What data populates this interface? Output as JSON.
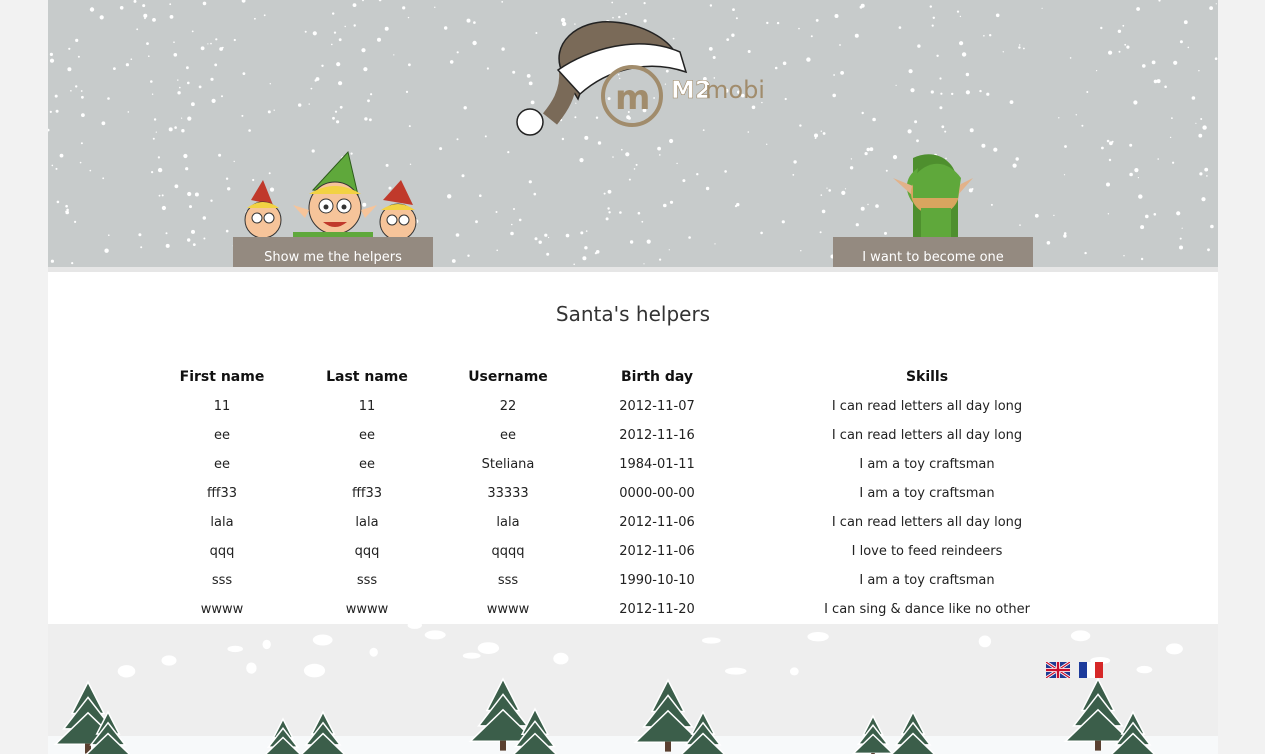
{
  "nav": {
    "helpers_label": "Show me the helpers",
    "become_label": "I want to become one"
  },
  "logo": {
    "text": "M2mobi",
    "brand_color": "#a18c6c"
  },
  "main": {
    "title": "Santa's helpers",
    "columns": [
      "First name",
      "Last name",
      "Username",
      "Birth day",
      "Skills"
    ],
    "rows": [
      [
        "11",
        "11",
        "22",
        "2012-11-07",
        "I can read letters all day long"
      ],
      [
        "ee",
        "ee",
        "ee",
        "2012-11-16",
        "I can read letters all day long"
      ],
      [
        "ee",
        "ee",
        "Steliana",
        "1984-01-11",
        "I am a toy craftsman"
      ],
      [
        "fff33",
        "fff33",
        "33333",
        "0000-00-00",
        "I am a toy craftsman"
      ],
      [
        "lala",
        "lala",
        "lala",
        "2012-11-06",
        "I can read letters all day long"
      ],
      [
        "qqq",
        "qqq",
        "qqqq",
        "2012-11-06",
        "I love to feed reindeers"
      ],
      [
        "sss",
        "sss",
        "sss",
        "1990-10-10",
        "I am a toy craftsman"
      ],
      [
        "wwww",
        "wwww",
        "wwww",
        "2012-11-20",
        "I can sing & dance like no other"
      ]
    ]
  },
  "footer": {
    "languages": [
      {
        "icon": "uk-flag-icon"
      },
      {
        "icon": "france-flag-icon"
      }
    ]
  },
  "colors": {
    "header_bg": "#c7cbcb",
    "button_bg": "#948a80",
    "page_bg": "#f2f2f2"
  }
}
